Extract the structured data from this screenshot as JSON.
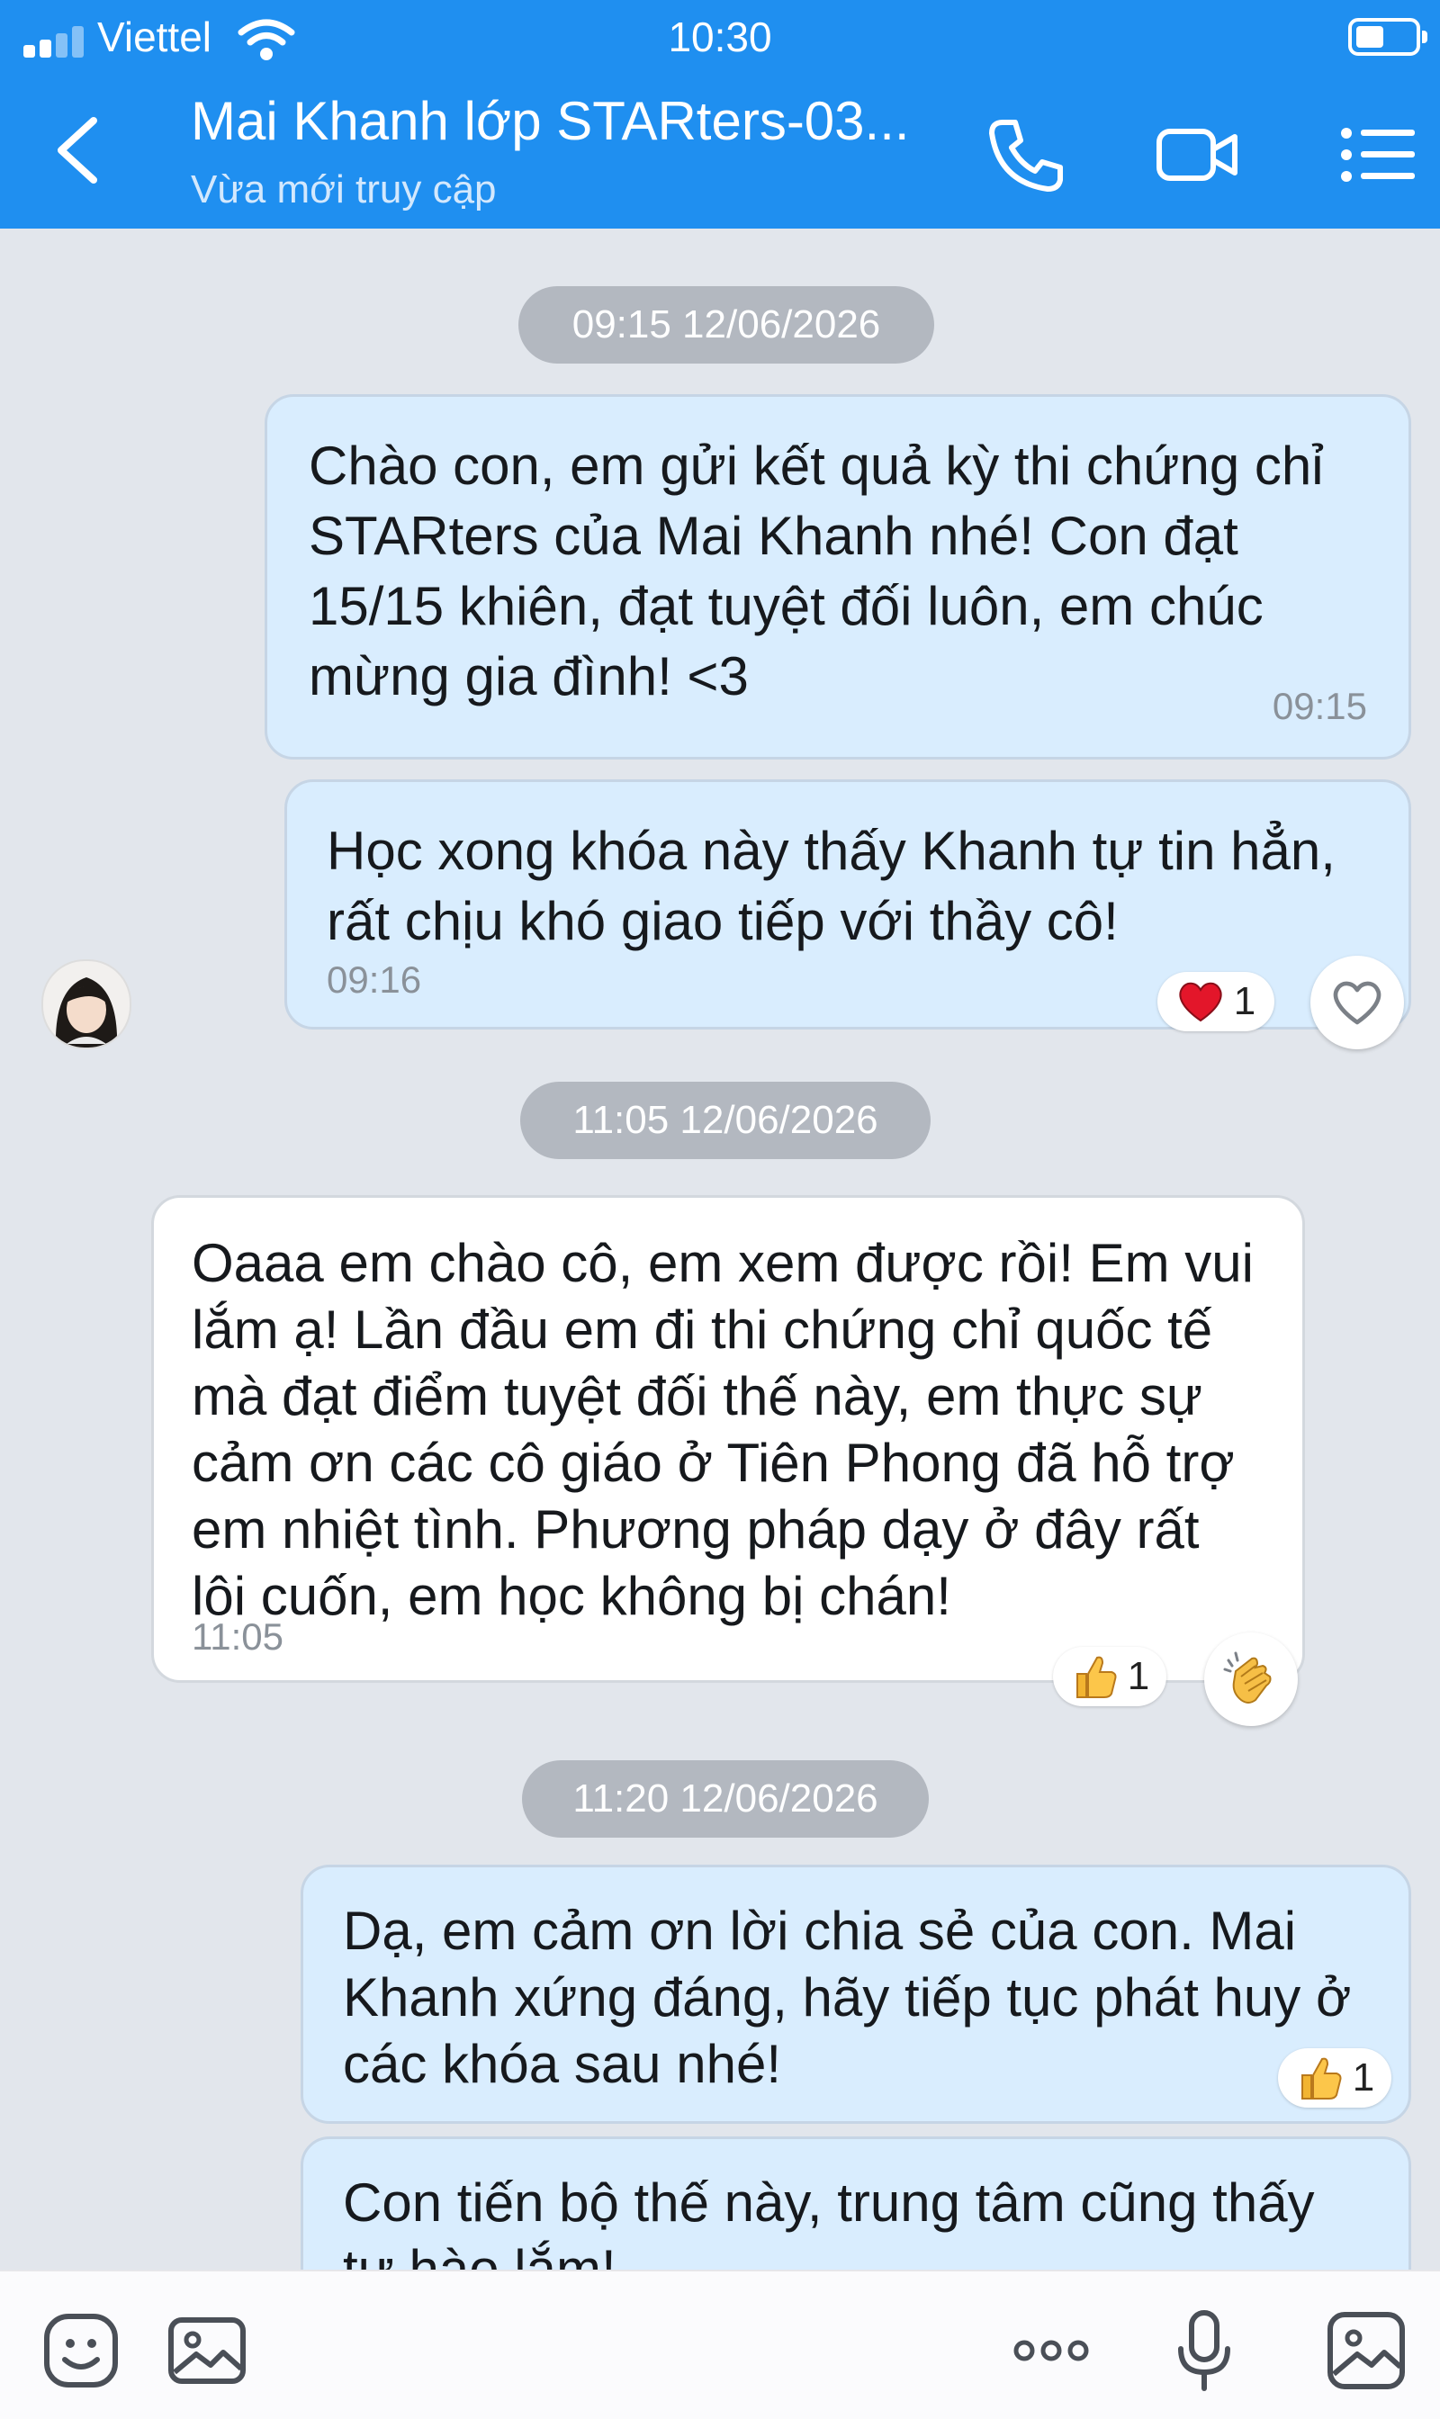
{
  "status_bar": {
    "carrier": "Viettel",
    "time": "10:30",
    "icons": [
      "signal-icon",
      "wifi-icon",
      "battery-icon"
    ]
  },
  "header": {
    "title": "Mai Khanh lớp STARters-03...",
    "subtitle": "Vừa mới truy cập",
    "icons": [
      "back-chevron-icon",
      "phone-icon",
      "video-camera-icon",
      "menu-list-icon"
    ]
  },
  "timestamps": [
    "09:15 12/06/2026",
    "11:05 12/06/2026",
    "11:20 12/06/2026"
  ],
  "messages": [
    {
      "direction": "out",
      "lines": [
        "Chào con, em gửi kết quả kỳ thi chứng chỉ",
        "STARters của Mai Khanh nhé! Con đạt",
        "15/15 khiên, đạt tuyệt đối luôn, em chúc",
        "mừng gia đình! <3"
      ],
      "time": "09:15"
    },
    {
      "direction": "out",
      "lines": [
        "Học xong khóa này thấy Khanh tự tin hẳn,",
        "rất chịu khó giao tiếp với thầy cô!"
      ],
      "time": "09:16",
      "reaction": {
        "icon": "heart-emoji-icon",
        "count": "1"
      }
    },
    {
      "direction": "in",
      "lines": [
        "Oaaa em chào cô, em xem được rồi! Em vui",
        "lắm ạ! Lần đầu em đi thi chứng chỉ quốc tế",
        "mà đạt điểm tuyệt đối thế này, em thực sự",
        "cảm ơn các cô giáo ở Tiên Phong đã hỗ trợ",
        "em nhiệt tình. Phương pháp dạy ở đây rất",
        "lôi cuốn, em học không bị chán!"
      ],
      "time": "11:05",
      "reaction": {
        "icon": "thumbs-up-emoji-icon",
        "count": "1"
      },
      "react_button": "clapping-hands-icon"
    },
    {
      "direction": "out",
      "lines": [
        "Dạ, em cảm ơn lời chia sẻ của con. Mai",
        "Khanh xứng đáng, hãy tiếp tục phát huy ở",
        "các khóa sau nhé!"
      ],
      "reaction": {
        "icon": "thumbs-up-emoji-icon",
        "count": "1"
      }
    },
    {
      "direction": "out",
      "lines": [
        "Con tiến bộ thế này, trung tâm cũng thấy",
        "tự hào lắm!"
      ]
    }
  ],
  "bottom_bar": {
    "icons": [
      "sticker-icon",
      "image-icon",
      "more-options-icon",
      "microphone-icon",
      "gallery-icon"
    ]
  },
  "colors": {
    "header_blue": "#1f8ff0",
    "outgoing_bubble": "#d9edfe",
    "incoming_bubble": "#ffffff",
    "chat_background": "#e2e6ec",
    "time_pill": "#b3b8c0"
  }
}
